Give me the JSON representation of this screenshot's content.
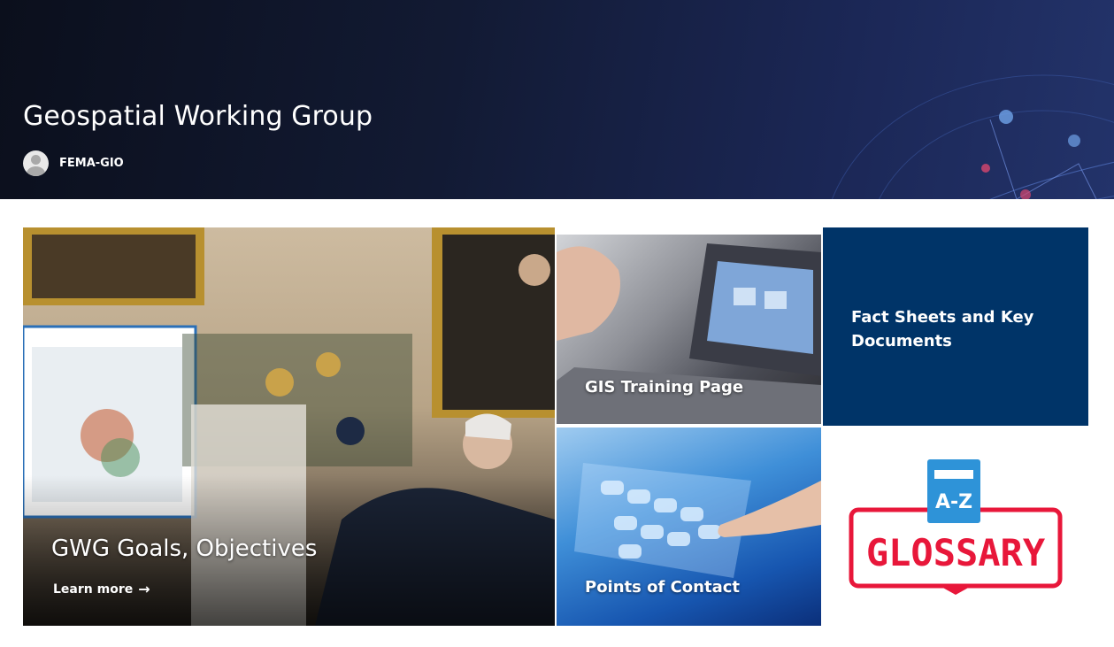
{
  "header": {
    "site_title": "Geospatial Working Group",
    "author": "FEMA-GIO"
  },
  "tiles": {
    "big": {
      "title": "GWG Goals, Objectives",
      "link_label": "Learn more"
    },
    "training": {
      "label": "GIS Training Page"
    },
    "facts": {
      "label": "Fact Sheets and Key Documents"
    },
    "contact": {
      "label": "Points of Contact"
    },
    "glossary": {
      "badge": "A-Z",
      "word": "GLOSSARY"
    }
  },
  "colors": {
    "facts_bg": "#003468",
    "glossary_red": "#e8173a",
    "glossary_blue": "#2e93d8"
  },
  "icons": [
    "avatar-icon",
    "arrow-right-icon",
    "glossary-book-icon"
  ]
}
